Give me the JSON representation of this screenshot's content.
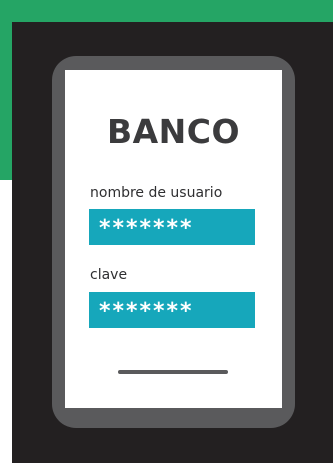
{
  "bank": {
    "title": "BANCO"
  },
  "form": {
    "username_label": "nombre de usuario",
    "username_value": "*******",
    "password_label": "clave",
    "password_value": "*******"
  },
  "colors": {
    "background_band": "#25a565",
    "panel": "#232021",
    "phone_frame": "#5a5a5c",
    "field": "#16a7bb"
  }
}
